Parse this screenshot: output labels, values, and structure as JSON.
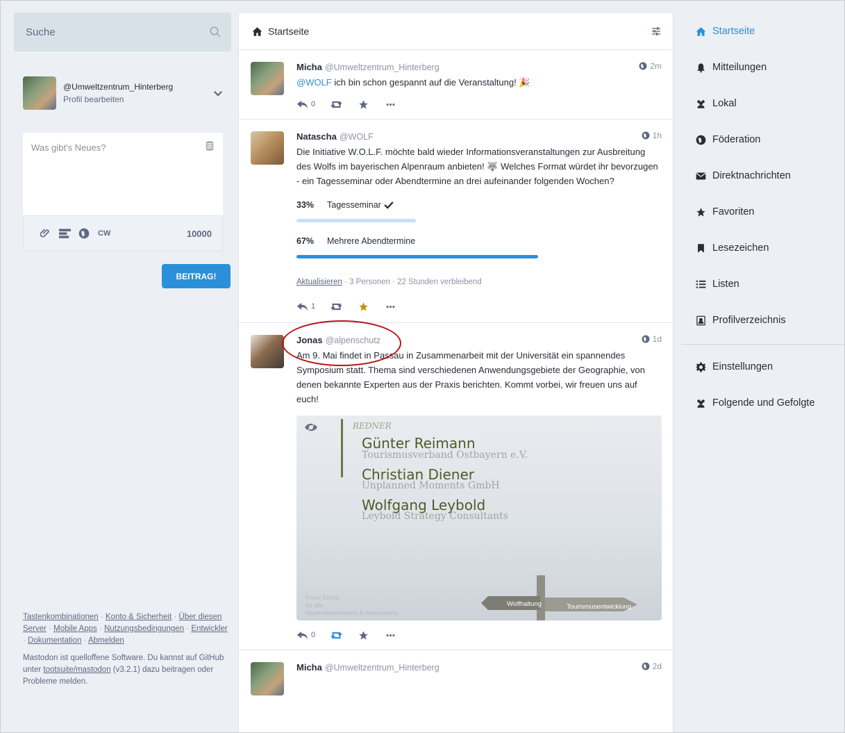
{
  "search": {
    "placeholder": "Suche"
  },
  "profile": {
    "handle": "@Umweltzentrum_Hinterberg",
    "edit_label": "Profil bearbeiten"
  },
  "compose": {
    "placeholder": "Was gibt's Neues?",
    "cw_label": "CW",
    "char_count": "10000",
    "publish_label": "BEITRAG!"
  },
  "footer": {
    "links": [
      "Tastenkombinationen",
      "Konto & Sicherheit",
      "Über diesen Server",
      "Mobile Apps",
      "Nutzungsbedingungen",
      "Entwickler",
      "Dokumentation",
      "Abmelden"
    ],
    "about_1": "Mastodon ist quelloffene Software. Du kannst auf GitHub unter ",
    "about_link": "tootsuite/mastodon",
    "about_version": " (v3.2.1)",
    "about_2": " dazu beitragen oder Probleme melden."
  },
  "column": {
    "title": "Startseite"
  },
  "statuses": [
    {
      "name": "Micha",
      "acct": "@Umweltzentrum_Hinterberg",
      "time": "2m",
      "mention": "@WOLF",
      "content": " ich bin schon gespannt auf die Veranstaltung! 🎉",
      "reply_count": "0"
    },
    {
      "name": "Natascha",
      "acct": "@WOLF",
      "time": "1h",
      "content": "Die Initiative W.O.L.F. möchte bald wieder Informationsveranstaltungen zur Ausbreitung des Wolfs im bayerischen Alpenraum anbieten! 🐺 Welches Format würdet ihr bevorzugen - ein Tagesseminar oder Abendtermine an drei aufeinander folgenden Wochen?",
      "poll": {
        "options": [
          {
            "percent_label": "33%",
            "value": 0.33,
            "label": "Tagesseminar",
            "voted": true
          },
          {
            "percent_label": "67%",
            "value": 0.67,
            "label": "Mehrere Abendtermine",
            "voted": false
          }
        ],
        "refresh_label": "Aktualisieren",
        "meta": " · 3 Personen · 22 Stunden verbleibend"
      },
      "reply_count": "1"
    },
    {
      "name": "Jonas",
      "acct": "@alpenschutz",
      "time": "1d",
      "content": "Am 9. Mai findet in Passau in Zusammenarbeit mit der Universität ein spannendes Symposium statt. Thema sind verschiedenen Anwendungsgebiete der Geographie, von denen bekannte Experten aus der Praxis berichten. Kommt vorbei, wir freuen uns auf euch!",
      "attachment": {
        "heading": "REDNER",
        "speakers": [
          {
            "name": "Günter Reimann",
            "org": "Tourismusverband Ostbayern e.V."
          },
          {
            "name": "Christian Diener",
            "org": "Unplanned Moments GmbH"
          },
          {
            "name": "Wolfgang Leybold",
            "org": "Leybold Strategy Consultants"
          }
        ],
        "side_note": [
          "Freier Eintritt",
          "für alle",
          "Studieninteressierte & Interessierte"
        ],
        "sign_left": "Wolfhaltung",
        "sign_right": "Tourismusentwicklung"
      },
      "reply_count": "0"
    },
    {
      "name": "Micha",
      "acct": "@Umweltzentrum_Hinterberg",
      "time": "2d"
    }
  ],
  "nav": {
    "items": [
      {
        "label": "Startseite",
        "icon": "home-icon",
        "active": true
      },
      {
        "label": "Mitteilungen",
        "icon": "bell-icon"
      },
      {
        "label": "Lokal",
        "icon": "users-icon"
      },
      {
        "label": "Föderation",
        "icon": "globe-icon"
      },
      {
        "label": "Direktnachrichten",
        "icon": "envelope-icon"
      },
      {
        "label": "Favoriten",
        "icon": "star-icon"
      },
      {
        "label": "Lesezeichen",
        "icon": "bookmark-icon"
      },
      {
        "label": "Listen",
        "icon": "list-icon"
      },
      {
        "label": "Profilverzeichnis",
        "icon": "address-book-icon"
      }
    ],
    "secondary": [
      {
        "label": "Einstellungen",
        "icon": "cog-icon"
      },
      {
        "label": "Folgende und Gefolgte",
        "icon": "users-icon"
      }
    ]
  },
  "colors": {
    "accent": "#2b90d9",
    "favourite": "#ca8f04",
    "annotation": "#b8141b",
    "background": "#eceff3"
  }
}
